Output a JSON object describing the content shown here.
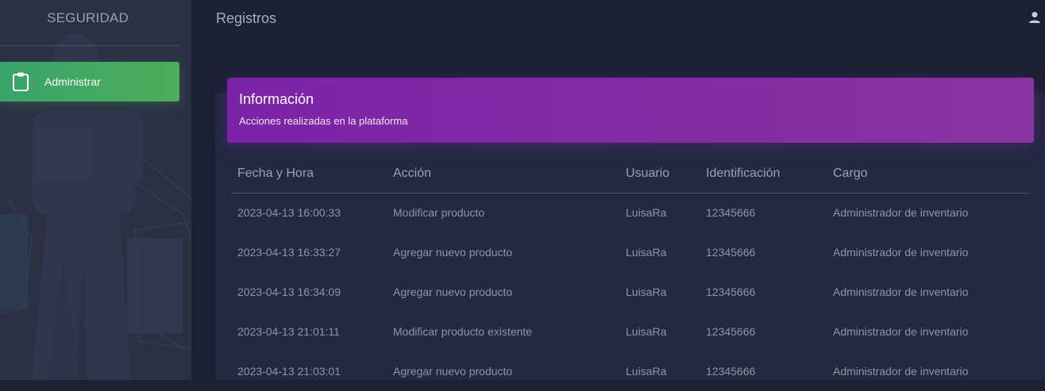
{
  "brand": "SEGURIDAD",
  "sidebar": {
    "items": [
      {
        "label": "Administrar",
        "icon": "clipboard-icon",
        "active": true
      }
    ]
  },
  "header": {
    "title": "Registros",
    "user_icon": "user-icon"
  },
  "card": {
    "title": "Información",
    "subtitle": "Acciones realizadas en la plataforma"
  },
  "table": {
    "columns": [
      "Fecha y Hora",
      "Acción",
      "Usuario",
      "Identificación",
      "Cargo"
    ],
    "rows": [
      [
        "2023-04-13 16:00:33",
        "Modificar producto",
        "LuisaRa",
        "12345666",
        "Administrador de inventario"
      ],
      [
        "2023-04-13 16:33:27",
        "Agregar nuevo producto",
        "LuisaRa",
        "12345666",
        "Administrador de inventario"
      ],
      [
        "2023-04-13 16:34:09",
        "Agregar nuevo producto",
        "LuisaRa",
        "12345666",
        "Administrador de inventario"
      ],
      [
        "2023-04-13 21:01:11",
        "Modificar producto existente",
        "LuisaRa",
        "12345666",
        "Administrador de inventario"
      ],
      [
        "2023-04-13 21:03:01",
        "Agregar nuevo producto",
        "LuisaRa",
        "12345666",
        "Administrador de inventario"
      ]
    ]
  },
  "colors": {
    "sidebar_bg": "#2b3045",
    "main_bg": "#1c2034",
    "active_item": "#4caf50",
    "card_header": "#7b23a6"
  }
}
